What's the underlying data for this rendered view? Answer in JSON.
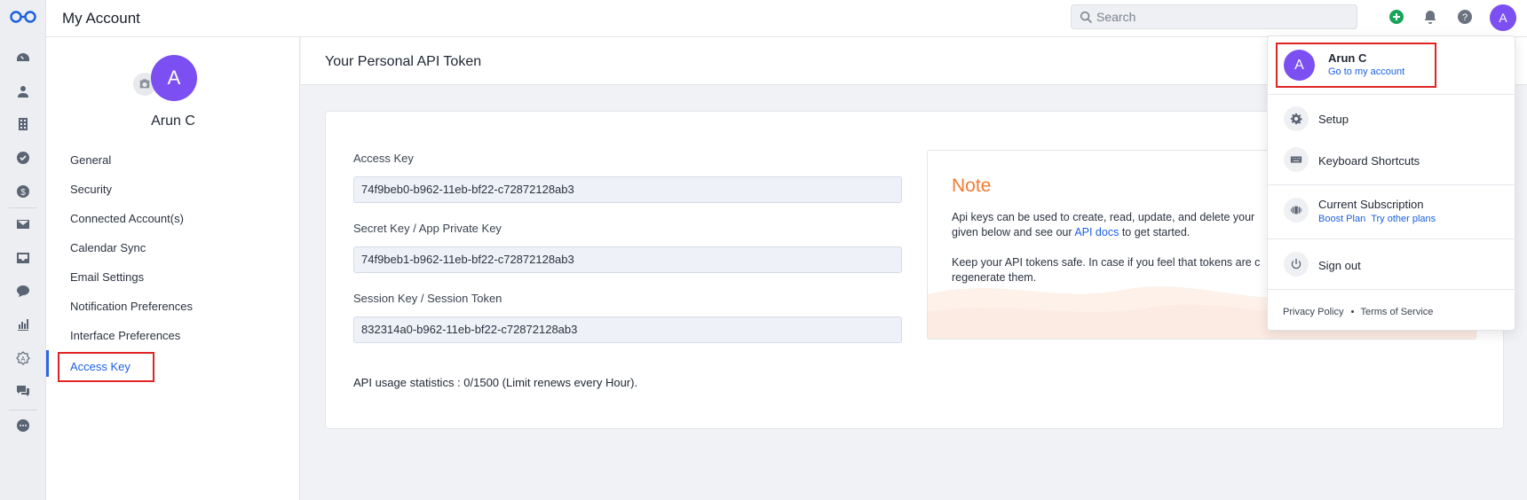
{
  "app": {
    "title": "My Account"
  },
  "search": {
    "placeholder": "Search"
  },
  "user": {
    "initial": "A",
    "name": "Arun C"
  },
  "rail": {
    "icons": [
      "dashboard-icon",
      "contacts-icon",
      "accounts-icon",
      "tasks-icon",
      "deals-icon",
      "email-icon",
      "inbox-icon",
      "chat-icon",
      "reports-icon",
      "automation-icon",
      "messages-icon",
      "more-icon"
    ]
  },
  "sidebar": {
    "items": [
      {
        "label": "General"
      },
      {
        "label": "Security"
      },
      {
        "label": "Connected Account(s)"
      },
      {
        "label": "Calendar Sync"
      },
      {
        "label": "Email Settings"
      },
      {
        "label": "Notification Preferences"
      },
      {
        "label": "Interface Preferences"
      },
      {
        "label": "Access Key"
      }
    ],
    "active_index": 7
  },
  "main": {
    "heading": "Your Personal API Token",
    "fields": [
      {
        "label": "Access Key",
        "value": "74f9beb0-b962-11eb-bf22-c72872128ab3"
      },
      {
        "label": "Secret Key / App Private Key",
        "value": "74f9beb1-b962-11eb-bf22-c72872128ab3"
      },
      {
        "label": "Session Key / Session Token",
        "value": "832314a0-b962-11eb-bf22-c72872128ab3"
      }
    ],
    "usage": "API usage statistics : 0/1500 (Limit renews every Hour)."
  },
  "note": {
    "title": "Note",
    "p1_a": "Api keys can be used to create, read, update, and delete your",
    "p1_b": "given below and see our",
    "p1_link": "API docs",
    "p1_c": "to get started.",
    "p2_a": "Keep your API tokens safe. In case if you feel that tokens are c",
    "p2_b": "regenerate them."
  },
  "dropdown": {
    "name": "Arun C",
    "account_link": "Go to my account",
    "setup": "Setup",
    "shortcuts": "Keyboard Shortcuts",
    "subscription": "Current Subscription",
    "plan": "Boost Plan",
    "try_plans": "Try other plans",
    "sign_out": "Sign out",
    "privacy": "Privacy Policy",
    "terms": "Terms of Service"
  },
  "colors": {
    "accent": "#7b4ff2",
    "link": "#1b5fe0",
    "note_title": "#f07b32",
    "highlight": "#e02424"
  }
}
